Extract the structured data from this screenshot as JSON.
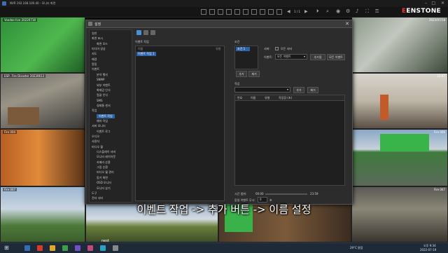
{
  "window": {
    "title": "NVR 192.168.100.40 - 모니터 화면"
  },
  "brand": {
    "prefix": "E",
    "name": "ENSTONE"
  },
  "toolbar": {
    "page_indicator": "1 / 1"
  },
  "cameras": [
    {
      "name": "Voodoo-live 20220718",
      "time": ""
    },
    {
      "name": "",
      "time": "2022/07/18"
    },
    {
      "name": "ESP...Fire Disaster 20220613",
      "time": ""
    },
    {
      "name": "",
      "time": "15:07"
    },
    {
      "name": "Fire 004",
      "time": ""
    },
    {
      "name": "",
      "time": "Fire 006"
    },
    {
      "name": "Fire 007",
      "time": ""
    },
    {
      "name": "",
      "time": "Fire 007"
    }
  ],
  "cam_watermark": "nest",
  "dialog": {
    "title": "설정",
    "close": "✕",
    "tree": [
      "일반",
      "화면 표시",
      "화면 모드",
      "미디어 영상",
      "지도",
      "배경",
      "알림",
      "이벤트",
      "분석 행사",
      "SNMP",
      "외부 이벤트",
      "화재감 인식",
      "얼굴 인식",
      "SMS",
      "실제통 센서",
      "작업",
      "이벤트 작업",
      "예약 작업",
      "서버 모니터",
      "이벤트 로그",
      "오디오",
      "사용자",
      "비디오 월",
      "디스플레이 서버",
      "모니터 레이아웃",
      "카메라 순환",
      "그림 순환",
      "비디오 월 관리",
      "동기 화면",
      "OSD 모니터",
      "모니터 뷰기",
      "도구",
      "전자 서버"
    ],
    "tree_selected": "이벤트 작업",
    "event_job_label": "이벤트 작업",
    "list_header_name": "이름",
    "list_header_type": "유형",
    "list_item": "이벤트 작업 1",
    "condition_label": "조건",
    "condition_item": "조건 1",
    "add_button": "추가",
    "delete_button": "제거",
    "server_label": "서버:",
    "server_checkbox": "모든 서버",
    "event_label": "이벤트:",
    "event_select": "모든 이벤트",
    "add_event_button": "추가됨",
    "all_events_button": "모든 이벤트",
    "action_label": "작업",
    "action_add_button": "추가",
    "action_delete_button": "제거",
    "action_headers": [
      "번호",
      "이름",
      "유형",
      "작업장 (초)"
    ],
    "time_range_label": "시간 범위:",
    "time_from": "00:00",
    "time_to": "23:59",
    "repeat_label": "동일 이벤트 무시:",
    "repeat_value": "0",
    "repeat_unit": "초"
  },
  "subtitle": "이벤트 작업 -> 추가 버튼 -> 이름 설정",
  "taskbar": {
    "weather": "29°C 맑음",
    "time": "오후 9:34",
    "date": "2022-07-19"
  }
}
